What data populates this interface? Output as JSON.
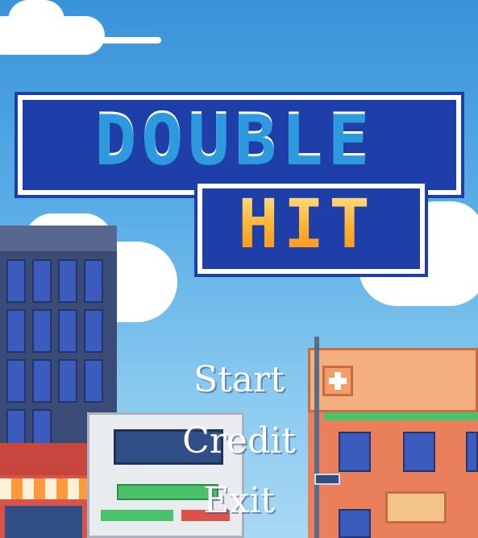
{
  "title": {
    "line1": "DOUBLE",
    "line2": "HIT"
  },
  "menu": {
    "items": [
      "Start",
      "Credit",
      "Exit"
    ]
  },
  "palette": {
    "sky": "#4aa3e2",
    "title_blue": "#1f3fa8",
    "title_gold": "#ffb02e",
    "shop_orange": "#ea7f5b"
  }
}
